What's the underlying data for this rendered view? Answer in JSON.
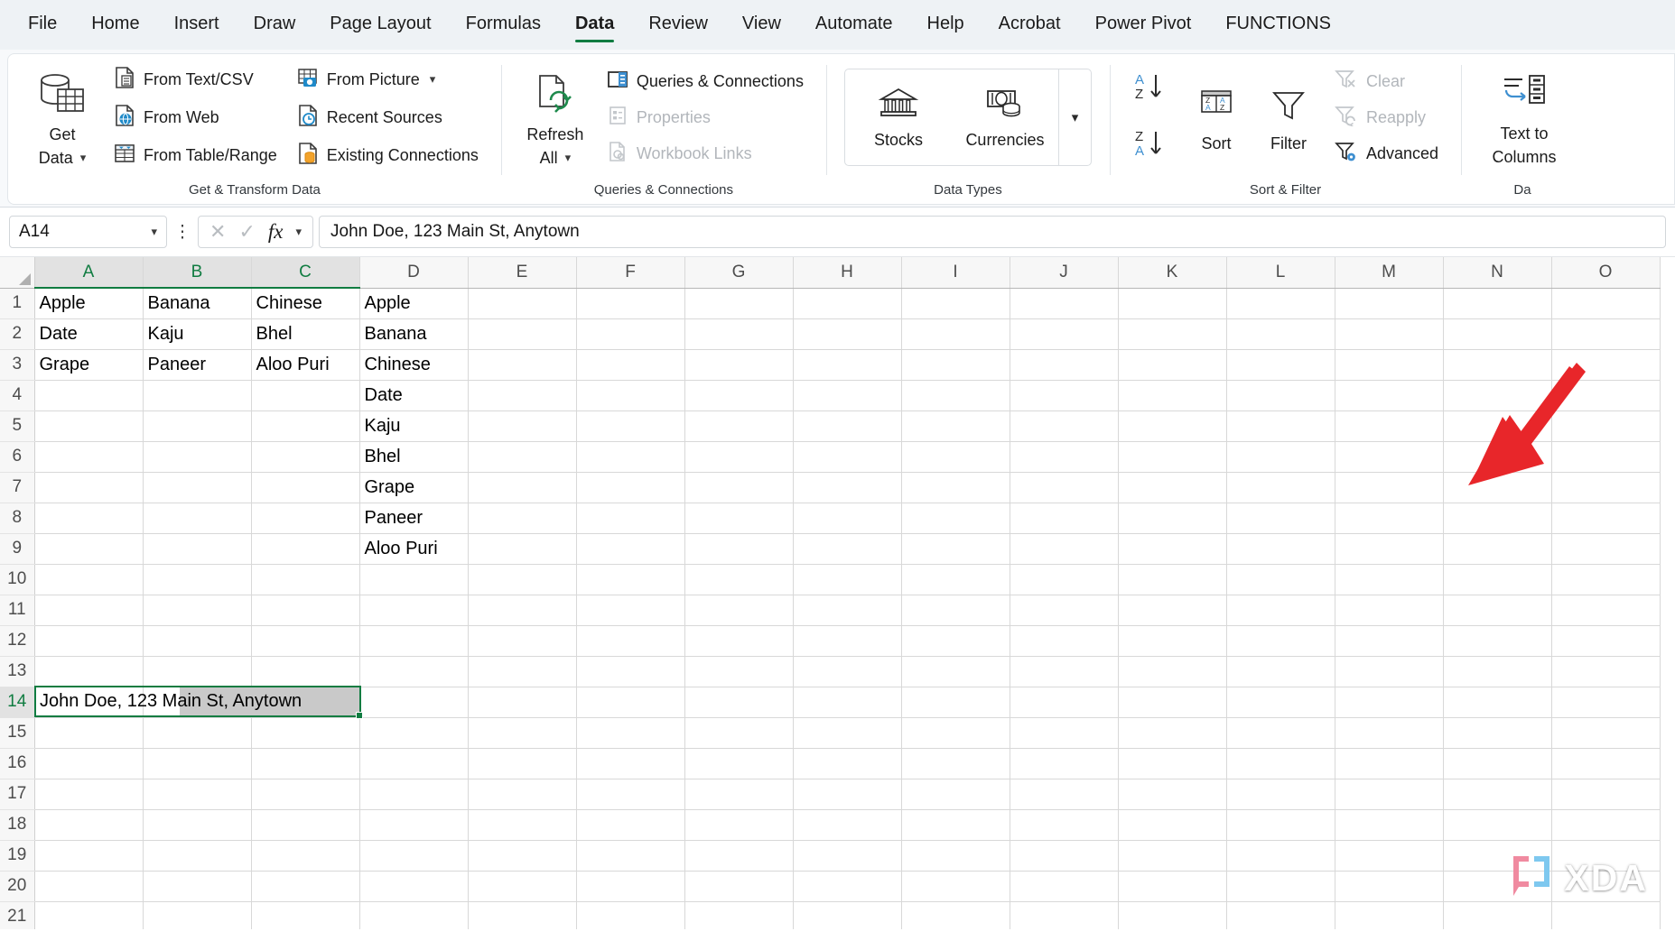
{
  "tabs": [
    {
      "label": "File",
      "active": false
    },
    {
      "label": "Home",
      "active": false
    },
    {
      "label": "Insert",
      "active": false
    },
    {
      "label": "Draw",
      "active": false
    },
    {
      "label": "Page Layout",
      "active": false
    },
    {
      "label": "Formulas",
      "active": false
    },
    {
      "label": "Data",
      "active": true
    },
    {
      "label": "Review",
      "active": false
    },
    {
      "label": "View",
      "active": false
    },
    {
      "label": "Automate",
      "active": false
    },
    {
      "label": "Help",
      "active": false
    },
    {
      "label": "Acrobat",
      "active": false
    },
    {
      "label": "Power Pivot",
      "active": false
    },
    {
      "label": "FUNCTIONS",
      "active": false
    }
  ],
  "ribbon": {
    "groups": [
      {
        "name": "get-transform-data",
        "label": "Get & Transform Data",
        "big_button": {
          "label_line1": "Get",
          "label_line2": "Data",
          "icon": "database-table-icon",
          "has_chevron": true
        },
        "column1": [
          {
            "label": "From Text/CSV",
            "icon": "text-csv-icon",
            "disabled": false,
            "chevron": false
          },
          {
            "label": "From Web",
            "icon": "globe-page-icon",
            "disabled": false,
            "chevron": false
          },
          {
            "label": "From Table/Range",
            "icon": "table-range-icon",
            "disabled": false,
            "chevron": false
          }
        ],
        "column2": [
          {
            "label": "From Picture",
            "icon": "picture-camera-icon",
            "disabled": false,
            "chevron": true
          },
          {
            "label": "Recent Sources",
            "icon": "recent-clock-icon",
            "disabled": false,
            "chevron": false
          },
          {
            "label": "Existing Connections",
            "icon": "existing-connections-icon",
            "disabled": false,
            "chevron": false
          }
        ]
      },
      {
        "name": "queries-connections",
        "label": "Queries & Connections",
        "big_button": {
          "label_line1": "Refresh",
          "label_line2": "All",
          "icon": "refresh-all-icon",
          "has_chevron": true
        },
        "column1": [
          {
            "label": "Queries & Connections",
            "icon": "queries-pane-icon",
            "disabled": false,
            "chevron": false
          },
          {
            "label": "Properties",
            "icon": "properties-icon",
            "disabled": true,
            "chevron": false
          },
          {
            "label": "Workbook Links",
            "icon": "workbook-links-icon",
            "disabled": true,
            "chevron": false
          }
        ]
      },
      {
        "name": "data-types",
        "label": "Data Types",
        "gallery": [
          {
            "label": "Stocks",
            "icon": "bank-stocks-icon"
          },
          {
            "label": "Currencies",
            "icon": "currency-money-icon"
          }
        ],
        "more_icon": "gallery-more-chevron-icon"
      },
      {
        "name": "sort-filter",
        "label": "Sort & Filter",
        "sort_asc_icon": "sort-a-to-z-icon",
        "sort_desc_icon": "sort-z-to-a-icon",
        "sort_button": {
          "label": "Sort",
          "icon": "sort-dialog-icon"
        },
        "filter_button": {
          "label": "Filter",
          "icon": "filter-funnel-icon"
        },
        "column1": [
          {
            "label": "Clear",
            "icon": "clear-filter-icon",
            "disabled": true
          },
          {
            "label": "Reapply",
            "icon": "reapply-filter-icon",
            "disabled": true
          },
          {
            "label": "Advanced",
            "icon": "advanced-filter-icon",
            "disabled": false
          }
        ]
      },
      {
        "name": "data-tools",
        "label": "Da",
        "big_button": {
          "label_line1": "Text to",
          "label_line2": "Columns",
          "icon": "text-to-columns-icon",
          "has_chevron": false
        }
      }
    ]
  },
  "formula_bar": {
    "name_box_value": "A14",
    "name_box_chevron_icon": "chevron-down-icon",
    "more_icon": "vertical-ellipsis-icon",
    "cancel_icon": "cancel-x-icon",
    "enter_icon": "confirm-check-icon",
    "fx_label": "fx",
    "fx_chevron_icon": "chevron-down-icon",
    "formula_value": "John Doe, 123 Main St, Anytown"
  },
  "grid": {
    "columns": [
      "A",
      "B",
      "C",
      "D",
      "E",
      "F",
      "G",
      "H",
      "I",
      "J",
      "K",
      "L",
      "M",
      "N",
      "O"
    ],
    "highlighted_columns": [
      "A",
      "B",
      "C"
    ],
    "rows": [
      1,
      2,
      3,
      4,
      5,
      6,
      7,
      8,
      9,
      10,
      11,
      12,
      13,
      14,
      15,
      16,
      17,
      18,
      19,
      20,
      21
    ],
    "highlighted_row": 14,
    "cells": {
      "A1": "Apple",
      "B1": "Banana",
      "C1": "Chinese",
      "D1": "Apple",
      "A2": "Date",
      "B2": "Kaju",
      "C2": "Bhel",
      "D2": "Banana",
      "A3": "Grape",
      "B3": "Paneer",
      "C3": "Aloo Puri",
      "D3": "Chinese",
      "D4": "Date",
      "D5": "Kaju",
      "D6": "Bhel",
      "D7": "Grape",
      "D8": "Paneer",
      "D9": "Aloo Puri"
    },
    "selected_cell": "A14",
    "selected_cell_value": "John Doe, 123 Main St, Anytown"
  },
  "annotation": {
    "arrow_color": "#e8262a",
    "arrow_name": "red-pointer-arrow"
  },
  "watermark": {
    "text": "XDA",
    "mark_icon": "xda-bracket-logo"
  }
}
